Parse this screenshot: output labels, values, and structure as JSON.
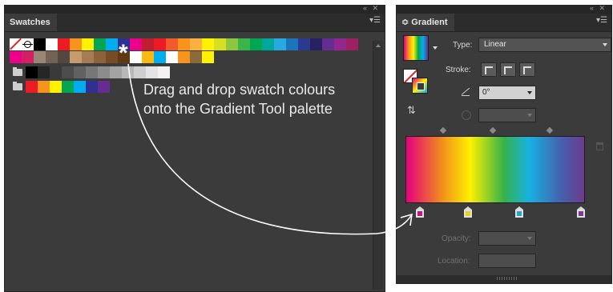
{
  "swatches_panel": {
    "tab_label": "Swatches",
    "row1_colors": [
      "#000000",
      "#ffffff",
      "#ed1c24",
      "#f7941d",
      "#fff200",
      "#00a651",
      "#00aeef",
      "#2e3192",
      "#ec008c",
      "#be1e2d",
      "#ed1c24",
      "#f15a29",
      "#f7941d",
      "#fbb040",
      "#fff200",
      "#d7df23",
      "#8dc63f",
      "#39b54a",
      "#00a651",
      "#00a79d",
      "#27aae1",
      "#1c75bc",
      "#2b3990",
      "#262262",
      "#662d91",
      "#92278f",
      "#9e1f63"
    ],
    "row2_colors": [
      "#ec008c",
      "#d31f64",
      "#998675",
      "#736357",
      "#534741",
      "#c69c6d",
      "#a67c52",
      "#8c6239",
      "#754c24",
      "#603813",
      "#ffffff",
      "#fdb913",
      "#00aeef",
      "#ffffff",
      "#f7941d",
      "#8b6b3b",
      "#fff200"
    ],
    "row3_colors": [
      "#000000",
      "#262626",
      "#3a3a3a",
      "#4d4d4d",
      "#616161",
      "#777777",
      "#8c8c8c",
      "#a3a3a3",
      "#b8b8b8",
      "#cfcfcf",
      "#e4e4e4",
      "#f2f2f2"
    ],
    "row4_colors": [
      "#ed1c24",
      "#f7941d",
      "#fff200",
      "#00a651",
      "#00aeef",
      "#2e3192",
      "#662d91"
    ]
  },
  "callout": {
    "line1": "Drag and drop swatch colours",
    "line2": "onto the Gradient Tool palette"
  },
  "gradient_panel": {
    "tab_label": "Gradient",
    "type_label": "Type:",
    "type_value": "Linear",
    "stroke_label": "Stroke:",
    "angle_value": "0°",
    "opacity_label": "Opacity:",
    "location_label": "Location:",
    "stop_colors": [
      "#c1177f",
      "#e8d31c",
      "#27a9c5",
      "#7a3e8f"
    ]
  }
}
